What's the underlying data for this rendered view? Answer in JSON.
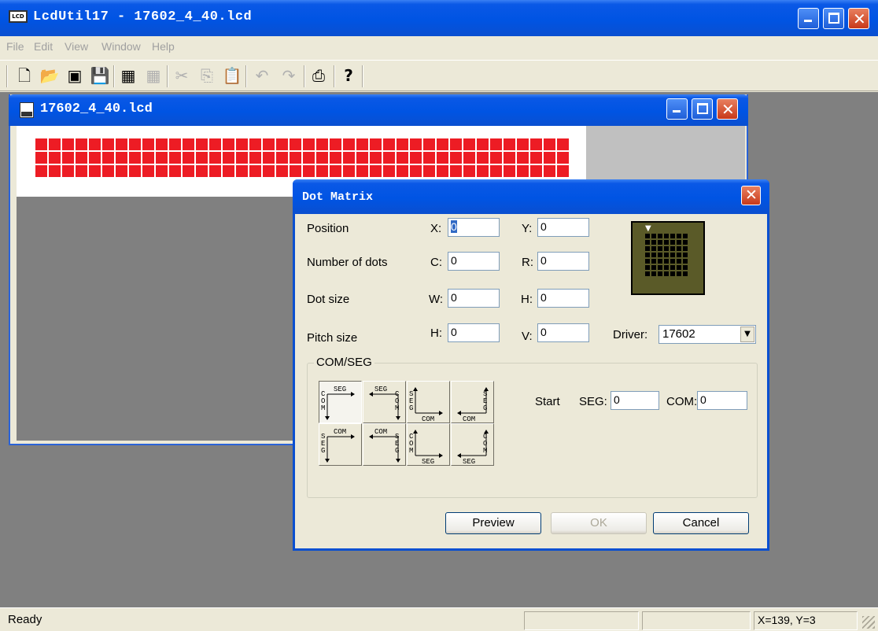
{
  "app": {
    "title": "LcdUtil17 - 17602_4_40.lcd",
    "icon_label": "LCD"
  },
  "menu": [
    "File",
    "Edit",
    "View",
    "Window",
    "Help"
  ],
  "toolbar": {
    "new": "🗋",
    "open": "📂",
    "import": "▣",
    "save": "💾",
    "grid": "▦",
    "grid2": "▦",
    "cut": "✂",
    "copy": "⎘",
    "paste": "📋",
    "undo": "↶",
    "redo": "↷",
    "print": "⎙",
    "help": "?"
  },
  "child": {
    "title": "17602_4_40.lcd"
  },
  "lcd": {
    "columns": 40,
    "rows": 3,
    "dot_color": "#ed1c24"
  },
  "dialog": {
    "title": "Dot Matrix",
    "position": {
      "label": "Position",
      "x_label": "X:",
      "x": "0",
      "y_label": "Y:",
      "y": "0"
    },
    "dots": {
      "label": "Number of dots",
      "c_label": "C:",
      "c": "0",
      "r_label": "R:",
      "r": "0"
    },
    "dot_size": {
      "label": "Dot size",
      "w_label": "W:",
      "w": "0",
      "h_label": "H:",
      "h": "0"
    },
    "pitch": {
      "label": "Pitch size",
      "h_label": "H:",
      "h": "0",
      "v_label": "V:",
      "v": "0"
    },
    "driver": {
      "label": "Driver:",
      "value": "17602"
    },
    "comseg": {
      "legend": "COM/SEG",
      "start_label": "Start",
      "seg_label": "SEG:",
      "seg": "0",
      "com_label": "COM:",
      "com": "0",
      "option_labels": [
        "SEG",
        "COM"
      ]
    },
    "buttons": {
      "preview": "Preview",
      "ok": "OK",
      "cancel": "Cancel"
    }
  },
  "status": {
    "ready": "Ready",
    "coords": "X=139, Y=3"
  }
}
